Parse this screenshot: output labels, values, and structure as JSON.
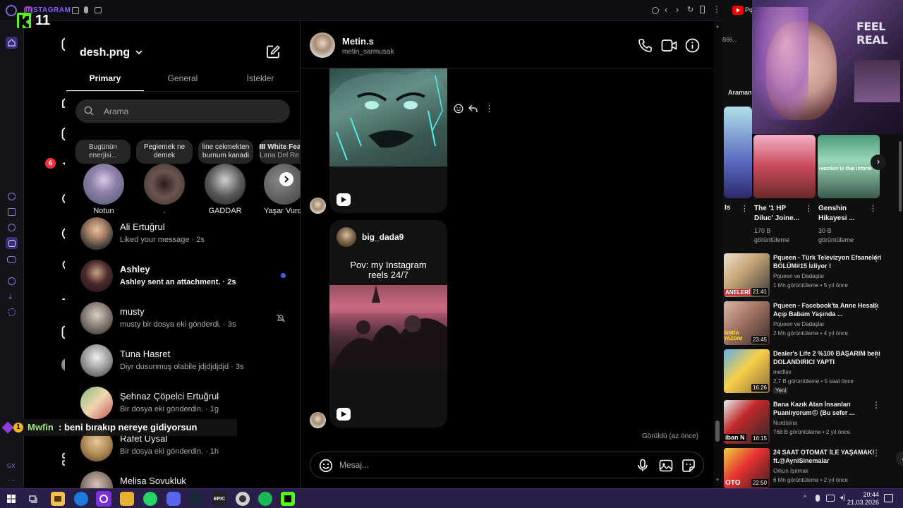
{
  "browser": {
    "tab_title": "INSTAGRAM",
    "right_tab_label": "Pq"
  },
  "overlay": {
    "kick_count": "11",
    "chat_badge": "1",
    "chat_user": "Mwfin",
    "chat_message": ": beni bırakıp nereye gidiyorsun"
  },
  "ig": {
    "notification_count": "6",
    "account_name": "desh.png",
    "tabs": [
      {
        "label": "Primary",
        "active": true
      },
      {
        "label": "General",
        "active": false
      },
      {
        "label": "İstekler",
        "active": false
      }
    ],
    "search_placeholder": "Arama",
    "notes": [
      {
        "line1": "Bugünün",
        "line2": "enerjisi..."
      },
      {
        "line1": "Peglemek ne",
        "line2": "demek"
      },
      {
        "line1": "line cekmekten",
        "line2": "burnum kanadi"
      },
      {
        "line1": "Ⅲ White Fea",
        "line2": "Lana Del Re"
      }
    ],
    "stories": [
      {
        "name": "Notun"
      },
      {
        "name": "."
      },
      {
        "name": "GADDAR"
      },
      {
        "name": "Yaşar Vurde"
      }
    ],
    "threads": [
      {
        "name": "Ali Ertuğrul",
        "preview": "Liked your message · 2s",
        "bold": false
      },
      {
        "name": "Ashley",
        "preview": "Ashley sent an attachment. · 2s",
        "bold": true
      },
      {
        "name": "musty",
        "preview": "musty bir dosya eki gönderdi. · 3s",
        "bold": false
      },
      {
        "name": "Tuna Hasret",
        "preview": "Diyr dusunmuş olabile jdjdjdjdjd · 3s",
        "bold": false
      },
      {
        "name": "Şehnaz Çöpelci Ertuğrul",
        "preview": "Bir dosya eki gönderdin. · 1g",
        "bold": false
      },
      {
        "name": "Rafet Uysal",
        "preview": "Bir dosya eki gönderdin. · 1h",
        "bold": false
      },
      {
        "name": "Melisa Sovukluk",
        "preview": "",
        "bold": false
      }
    ]
  },
  "chat": {
    "contact_name": "Metin.s",
    "contact_username": "metin_sarmusak",
    "reel_author": "big_dada9",
    "reel_caption_line1": "Pov: my Instagram",
    "reel_caption_line2": "reels 24/7",
    "seen_status": "Görüldü (az önce)",
    "message_placeholder": "Mesaj..."
  },
  "youtube": {
    "top_channel_label": "Pq",
    "cam_overlay_text": "FEEL REAL",
    "search_fragment": "Araman",
    "shorts": [
      {
        "title_line1": "Is",
        "title_line2": "",
        "views_line1": "",
        "views_line2": ""
      },
      {
        "title_line1": "The '1 HP",
        "title_line2": "Diluc' Joine...",
        "views_line1": "170 B",
        "views_line2": "görüntüleme"
      },
      {
        "title_line1": "Genshin",
        "title_line2": "Hikayesi ...",
        "views_line1": "30 B",
        "views_line2": "görüntüleme"
      }
    ],
    "short_thumb_caption": "reaction to that inform",
    "videos": [
      {
        "title": "Pqueen - Türk Televizyon Efsaneleri BÖLÜM#15 İzliyor !",
        "channel": "Pqueen ve Dadaşlar",
        "stats": "1 Mn görüntüleme • 5 yıl önce",
        "duration": "21:41",
        "thumb_text": "ANELERİ",
        "badge": ""
      },
      {
        "title": "Pqueen - Facebook'ta Anne Hesabı Açıp Babam Yaşında ...",
        "channel": "Pqueen ve Dadaşlar",
        "stats": "2 Mn görüntüleme • 4 yıl önce",
        "duration": "23:45",
        "thumb_text": "SINDA YAZDIM",
        "badge": ""
      },
      {
        "title": "Dealer's Life 2 %100 BAŞARIM beni DOLANDIRICI YAPTI",
        "channel": "metflex",
        "stats": "2,7 B görüntüleme • 5 saat önce",
        "duration": "16:26",
        "thumb_text": "",
        "badge": "Yeni"
      },
      {
        "title": "Bana Kazık Atan İnsanları Puanlıyorum😡 (Bu sefer ...",
        "channel": "Nurdisina",
        "stats": "768 B görüntüleme • 2 yıl önce",
        "duration": "16:15",
        "thumb_text": "iban N",
        "badge": ""
      },
      {
        "title": "24 SAAT OTOMAT İLE YAŞAMAK! ft.@AyniSinemalar",
        "channel": "Orkun Işıtmak",
        "stats": "6 Mn görüntüleme • 2 yıl önce",
        "duration": "22:50",
        "thumb_text": "OTO",
        "badge": ""
      }
    ]
  },
  "taskbar": {
    "time": "20:44",
    "date": "21.03.2026"
  }
}
